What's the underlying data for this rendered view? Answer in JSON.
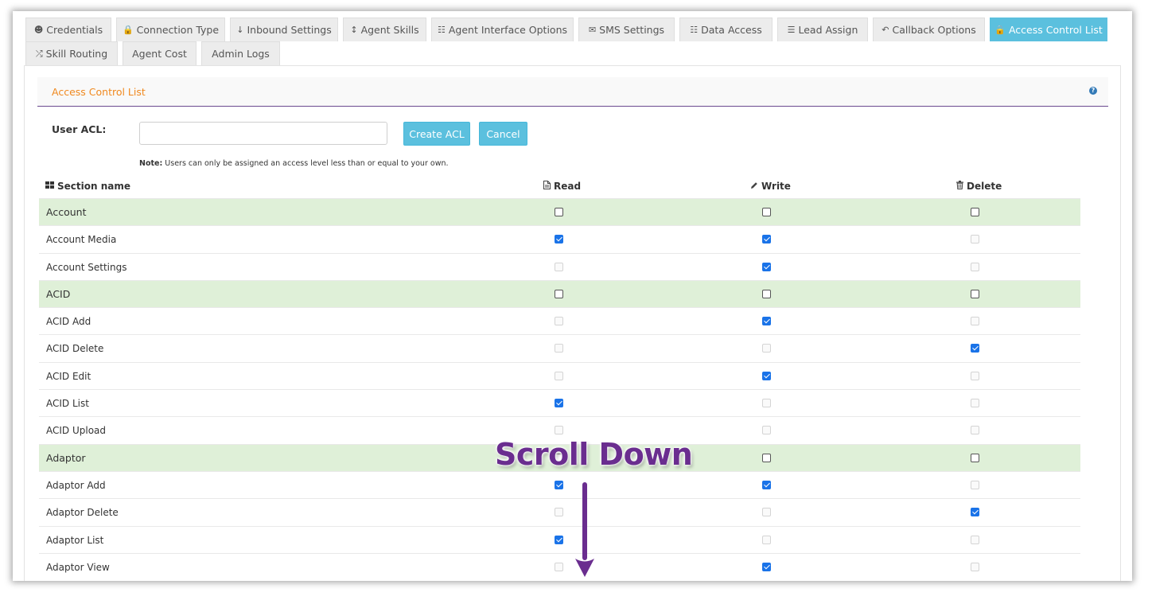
{
  "tabs_row1": [
    {
      "label": "Credentials",
      "icon": "user-icon",
      "glyph": "☻",
      "active": false,
      "width": 108
    },
    {
      "label": "Connection Type",
      "icon": "lock-icon",
      "glyph": "🔒",
      "active": false,
      "width": 137
    },
    {
      "label": "Inbound Settings",
      "icon": "arrow-down-icon",
      "glyph": "↓",
      "active": false,
      "width": 136
    },
    {
      "label": "Agent Skills",
      "icon": "arrows-vertical-icon",
      "glyph": "↕",
      "active": false,
      "width": 105
    },
    {
      "label": "Agent Interface Options",
      "icon": "grid-icon",
      "glyph": "☷",
      "active": false,
      "width": 179
    },
    {
      "label": "SMS Settings",
      "icon": "envelope-icon",
      "glyph": "✉",
      "active": false,
      "width": 121
    },
    {
      "label": "Data Access",
      "icon": "grid-icon",
      "glyph": "☷",
      "active": false,
      "width": 117
    },
    {
      "label": "Lead Assign",
      "icon": "list-ordered-icon",
      "glyph": "☰",
      "active": false,
      "width": 114
    },
    {
      "label": "Callback Options",
      "icon": "reply-icon",
      "glyph": "↶",
      "active": false,
      "width": 141
    },
    {
      "label": "Access Control List",
      "icon": "lock-icon",
      "glyph": "🔒",
      "active": true,
      "width": 148
    }
  ],
  "tabs_row2": [
    {
      "label": "Skill Routing",
      "icon": "shuffle-icon",
      "glyph": "⤮",
      "active": false,
      "width": 116
    },
    {
      "label": "Agent Cost",
      "icon": "",
      "glyph": "",
      "active": false,
      "width": 93
    },
    {
      "label": "Admin Logs",
      "icon": "",
      "glyph": "",
      "active": false,
      "width": 99
    }
  ],
  "panel": {
    "title": "Access Control List",
    "help": "?"
  },
  "acl_form": {
    "label": "User ACL:",
    "value": "",
    "placeholder": "",
    "create_label": "Create ACL",
    "cancel_label": "Cancel",
    "note_bold": "Note:",
    "note_text": " Users can only be assigned an access level less than or equal to your own."
  },
  "columns": {
    "section": "Section name",
    "read": "Read",
    "write": "Write",
    "delete": "Delete"
  },
  "rows": [
    {
      "name": "Account",
      "group": true,
      "read": "off",
      "write": "off",
      "delete": "off"
    },
    {
      "name": "Account Media",
      "group": false,
      "read": "on",
      "write": "on",
      "delete": "dis"
    },
    {
      "name": "Account Settings",
      "group": false,
      "read": "dis",
      "write": "on",
      "delete": "dis"
    },
    {
      "name": "ACID",
      "group": true,
      "read": "off",
      "write": "off",
      "delete": "off"
    },
    {
      "name": "ACID Add",
      "group": false,
      "read": "dis",
      "write": "on",
      "delete": "dis"
    },
    {
      "name": "ACID Delete",
      "group": false,
      "read": "dis",
      "write": "dis",
      "delete": "on"
    },
    {
      "name": "ACID Edit",
      "group": false,
      "read": "dis",
      "write": "on",
      "delete": "dis"
    },
    {
      "name": "ACID List",
      "group": false,
      "read": "on",
      "write": "dis",
      "delete": "dis"
    },
    {
      "name": "ACID Upload",
      "group": false,
      "read": "dis",
      "write": "dis",
      "delete": "dis"
    },
    {
      "name": "Adaptor",
      "group": true,
      "read": "off",
      "write": "off",
      "delete": "off"
    },
    {
      "name": "Adaptor Add",
      "group": false,
      "read": "on",
      "write": "on",
      "delete": "dis"
    },
    {
      "name": "Adaptor Delete",
      "group": false,
      "read": "dis",
      "write": "dis",
      "delete": "on"
    },
    {
      "name": "Adaptor List",
      "group": false,
      "read": "on",
      "write": "dis",
      "delete": "dis"
    },
    {
      "name": "Adaptor View",
      "group": false,
      "read": "dis",
      "write": "on",
      "delete": "dis"
    }
  ],
  "overlay": {
    "text": "Scroll Down",
    "color": "#6a2d8f"
  },
  "colors": {
    "accent": "#5bc0de",
    "group_row": "#dff0d8",
    "title": "#f0891f",
    "divider": "#6b4a8f",
    "checkbox_checked": "#1a73e8"
  }
}
